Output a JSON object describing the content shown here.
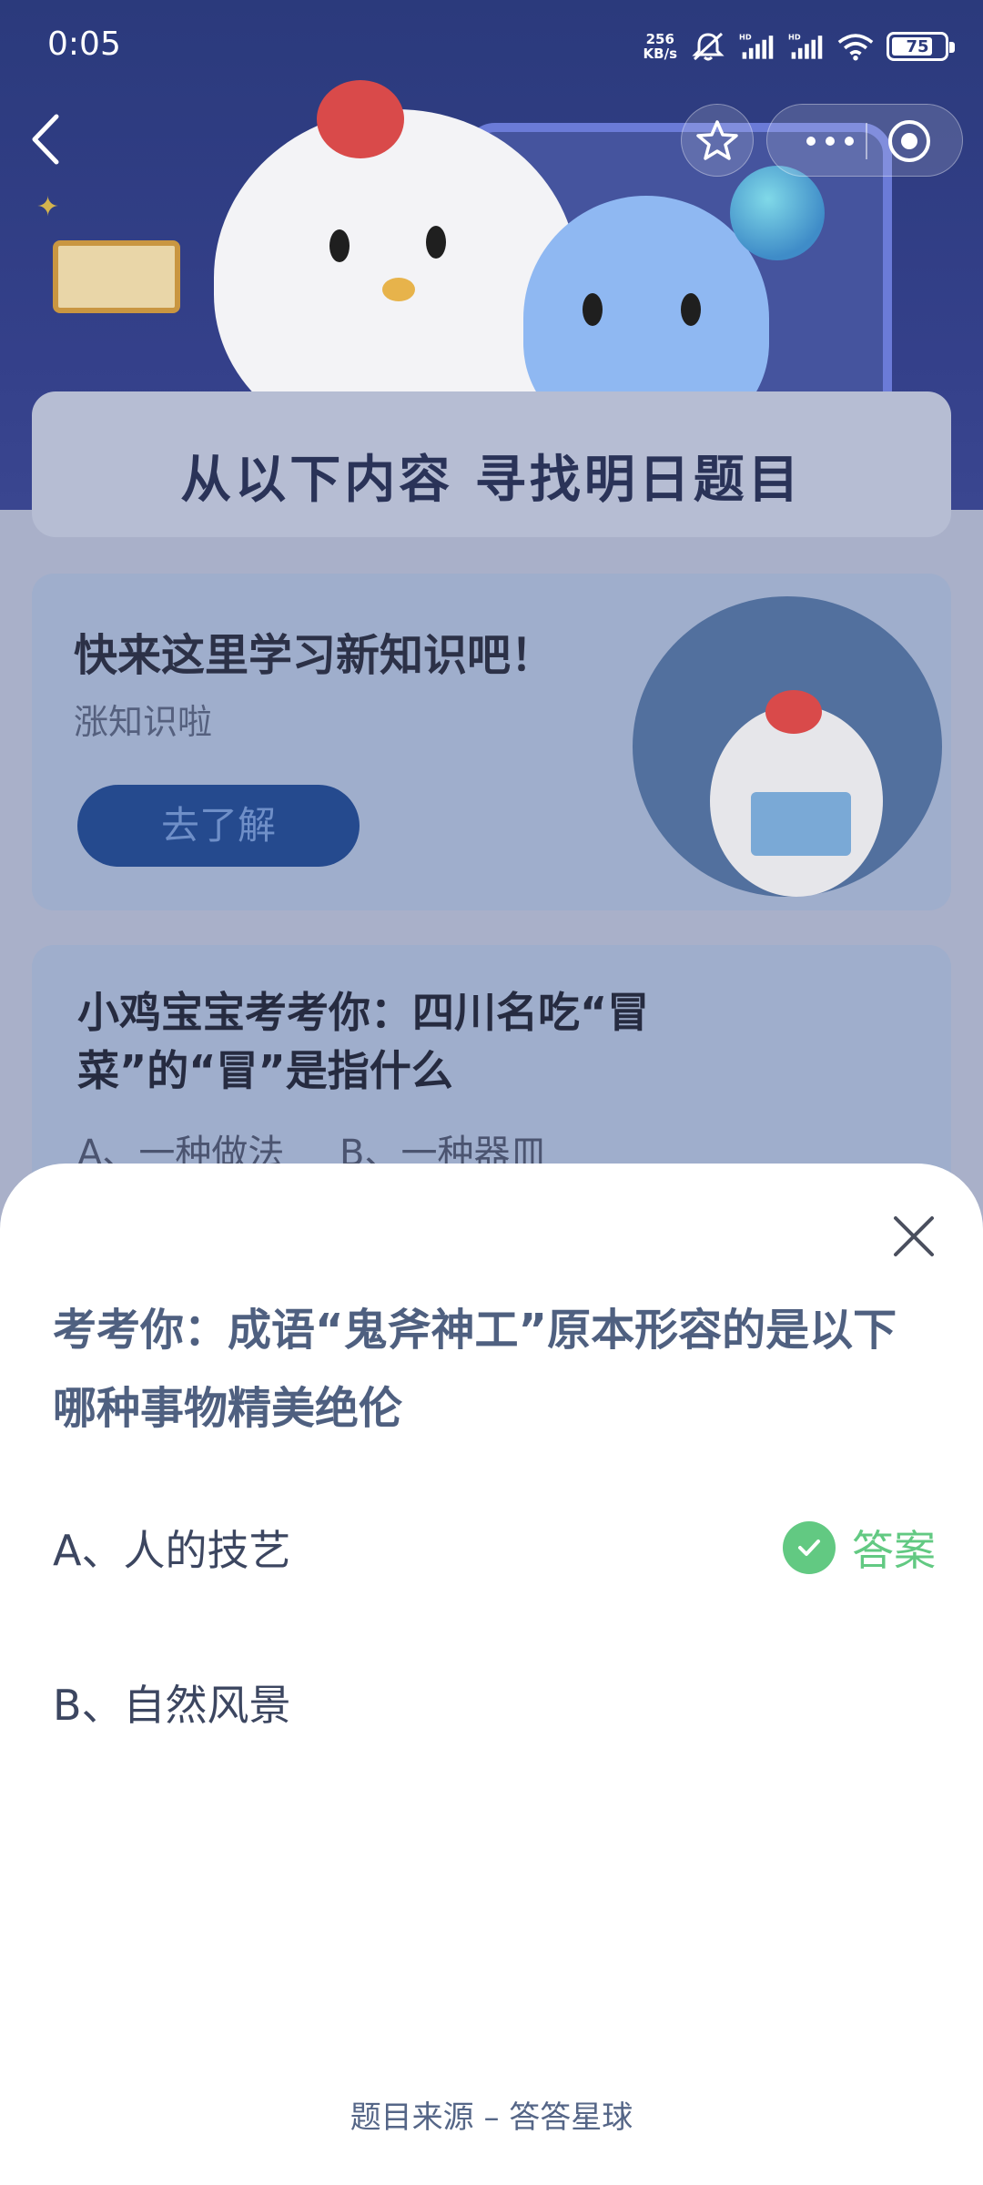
{
  "status_bar": {
    "time": "0:05",
    "net_speed_value": "256",
    "net_speed_unit": "KB/s",
    "battery": "75"
  },
  "nav": {
    "back_icon": "chevron-left-icon",
    "favorite_icon": "star-icon",
    "more_icon": "more-dots-icon",
    "close_icon": "target-circle-icon"
  },
  "background": {
    "section_title": "从以下内容 寻找明日题目",
    "promo_card": {
      "title": "快来这里学习新知识吧！",
      "subtitle": "涨知识啦",
      "button": "去了解"
    },
    "quiz_card": {
      "title": "小鸡宝宝考考你：四川名吃“冒菜”的“冒”是指什么",
      "option_a": "A、一种做法",
      "option_b": "B、一种器皿"
    }
  },
  "sheet": {
    "question": "考考你：成语“鬼斧神工”原本形容的是以下哪种事物精美绝伦",
    "options": [
      {
        "label": "A、人的技艺",
        "is_answer": true
      },
      {
        "label": "B、自然风景",
        "is_answer": false
      }
    ],
    "answer_label": "答案",
    "source": "题目来源 – 答答星球"
  },
  "colors": {
    "answer_green": "#62c982",
    "question_text": "#4f6080",
    "hero_bg": "#2b3a7c"
  }
}
